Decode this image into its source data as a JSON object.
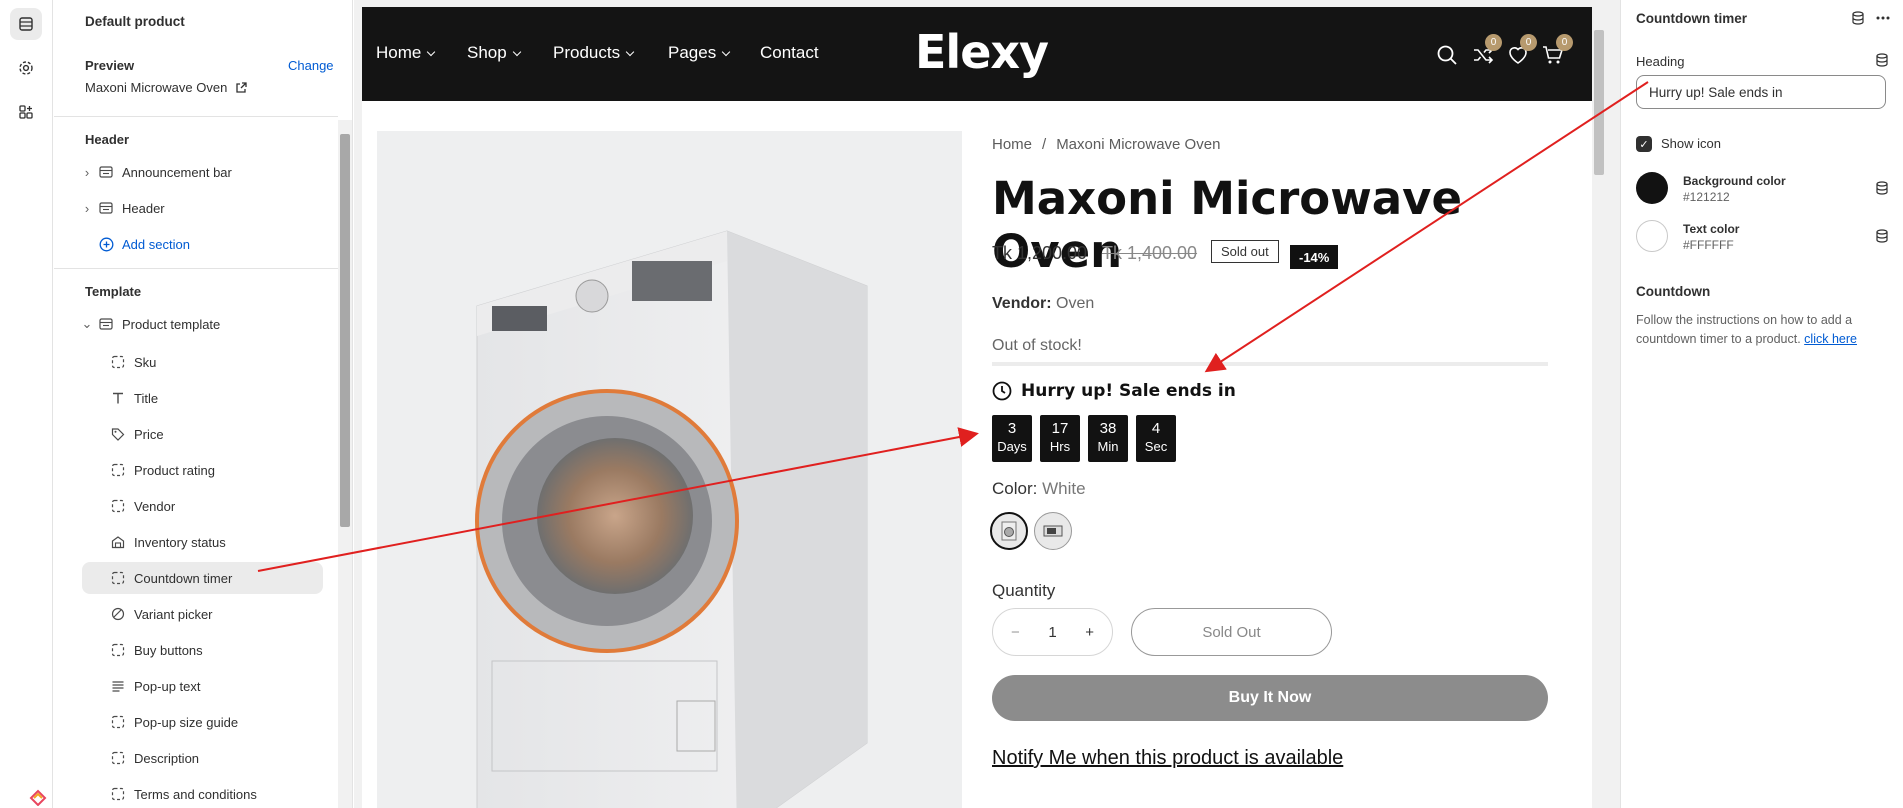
{
  "sidebar": {
    "title": "Default product",
    "preview_label": "Preview",
    "change_label": "Change",
    "preview_value": "Maxoni Microwave Oven",
    "header_group": "Header",
    "header_items": [
      {
        "label": "Announcement bar",
        "icon": "section-icon"
      },
      {
        "label": "Header",
        "icon": "section-icon"
      }
    ],
    "add_section": "Add section",
    "template_group": "Template",
    "template_item": "Product template",
    "blocks": [
      {
        "label": "Sku",
        "icon": "block-dashed-icon"
      },
      {
        "label": "Title",
        "icon": "text-title-icon"
      },
      {
        "label": "Price",
        "icon": "price-tag-icon"
      },
      {
        "label": "Product rating",
        "icon": "block-dashed-icon"
      },
      {
        "label": "Vendor",
        "icon": "block-dashed-icon"
      },
      {
        "label": "Inventory status",
        "icon": "inventory-icon"
      },
      {
        "label": "Countdown timer",
        "icon": "block-dashed-icon"
      },
      {
        "label": "Variant picker",
        "icon": "variant-icon"
      },
      {
        "label": "Buy buttons",
        "icon": "block-dashed-icon"
      },
      {
        "label": "Pop-up text",
        "icon": "text-lines-icon"
      },
      {
        "label": "Pop-up size guide",
        "icon": "block-dashed-icon"
      },
      {
        "label": "Description",
        "icon": "block-dashed-icon"
      },
      {
        "label": "Terms and conditions",
        "icon": "block-dashed-icon"
      }
    ]
  },
  "store": {
    "nav": [
      {
        "label": "Home",
        "dropdown": true
      },
      {
        "label": "Shop",
        "dropdown": true
      },
      {
        "label": "Products",
        "dropdown": true
      },
      {
        "label": "Pages",
        "dropdown": true
      },
      {
        "label": "Contact",
        "dropdown": false
      }
    ],
    "logo": "Elexy",
    "badges": {
      "compare": "0",
      "wishlist": "0",
      "cart": "0"
    },
    "breadcrumb": {
      "home": "Home",
      "sep": "/",
      "current": "Maxoni Microwave Oven"
    },
    "product_title": "Maxoni Microwave Oven",
    "price": "Tk 1,200.00",
    "compare_price": "Tk 1,400.00",
    "sold_out_badge": "Sold out",
    "discount_badge": "-14%",
    "vendor_label": "Vendor:",
    "vendor_value": "Oven",
    "stock_text": "Out of stock!",
    "countdown": {
      "heading": "Hurry up! Sale ends in",
      "units": [
        {
          "value": "3",
          "unit": "Days"
        },
        {
          "value": "17",
          "unit": "Hrs"
        },
        {
          "value": "38",
          "unit": "Min"
        },
        {
          "value": "4",
          "unit": "Sec"
        }
      ]
    },
    "color_label": "Color:",
    "color_value": "White",
    "quantity_label": "Quantity",
    "quantity_value": "1",
    "qty_minus": "−",
    "qty_plus": "+",
    "sold_out_button": "Sold Out",
    "buy_now": "Buy It Now",
    "notify": "Notify Me when this product is available"
  },
  "settings": {
    "title": "Countdown timer",
    "heading_label": "Heading",
    "heading_value": "Hurry up! Sale ends in",
    "show_icon_label": "Show icon",
    "show_icon_checked": true,
    "bg_color_label": "Background color",
    "bg_color_hex": "#121212",
    "text_color_label": "Text color",
    "text_color_hex": "#FFFFFF",
    "countdown_section": "Countdown",
    "help_text": "Follow the instructions on how to add a countdown timer to a product.",
    "help_link": "click here"
  },
  "colors": {
    "accent_link": "#005bd3",
    "nav_bg": "#141414",
    "badge_gold": "#b79a6e",
    "annotation_red": "#e0201f"
  }
}
